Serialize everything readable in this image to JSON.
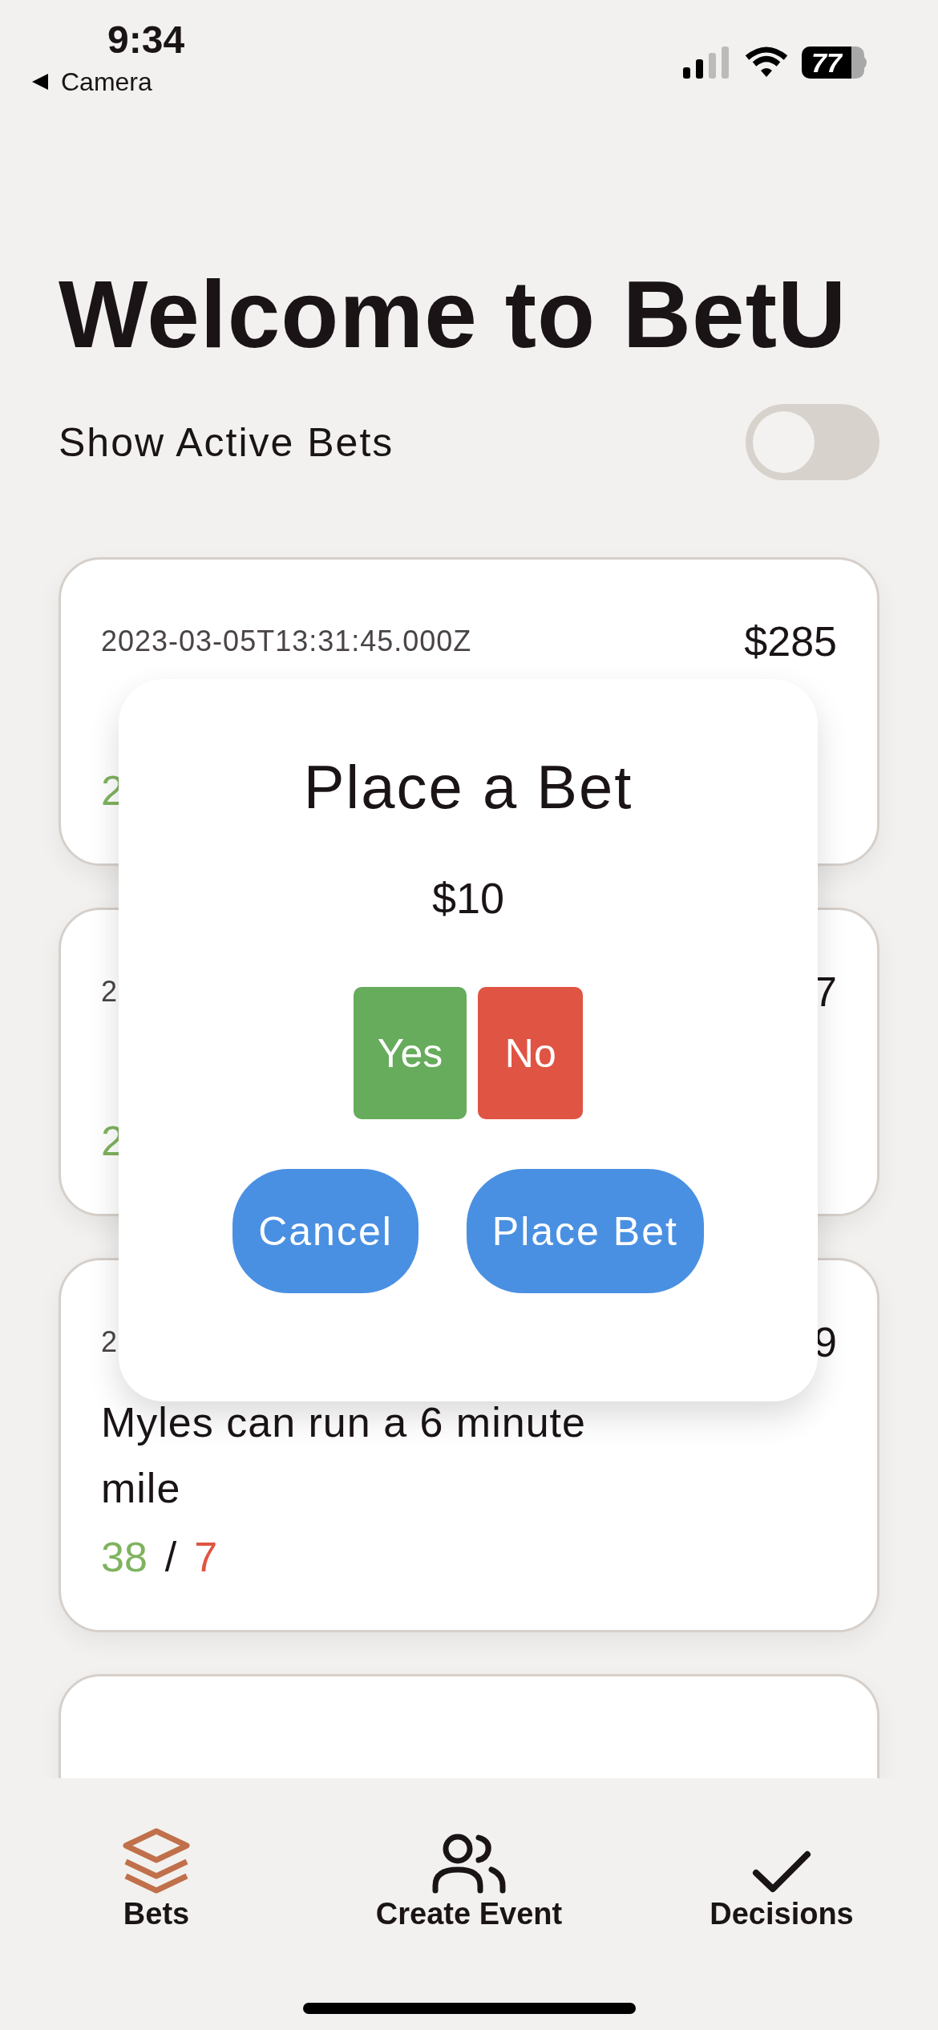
{
  "status_bar": {
    "time": "9:34",
    "back_label": "Camera",
    "battery": "77"
  },
  "title": "Welcome to BetU",
  "active_toggle": {
    "label": "Show Active Bets",
    "on": false
  },
  "bets": [
    {
      "kind": "card",
      "date": "2023-03-05T13:31:45.000Z",
      "amount": "$285",
      "yes_count": "2"
    },
    {
      "kind": "card",
      "date": "2",
      "amount": "7",
      "yes_count": "2"
    },
    {
      "kind": "card",
      "date": "2",
      "amount": "9",
      "title": "Myles can run a 6 minute mile",
      "yes_count": "38",
      "separator": "/",
      "no_count": "7"
    },
    {
      "kind": "cut"
    }
  ],
  "modal": {
    "title": "Place a Bet",
    "amount": "$10",
    "choices": [
      {
        "label": "Yes",
        "color": "#67ac5c"
      },
      {
        "label": "No",
        "color": "#e05443"
      }
    ],
    "actions": [
      "Cancel",
      "Place Bet"
    ]
  },
  "tabs": [
    {
      "label": "Bets",
      "kind": "layers",
      "selected": true
    },
    {
      "label": "Create Event",
      "kind": "people",
      "selected": false
    },
    {
      "label": "Decisions",
      "kind": "check",
      "selected": false
    }
  ]
}
